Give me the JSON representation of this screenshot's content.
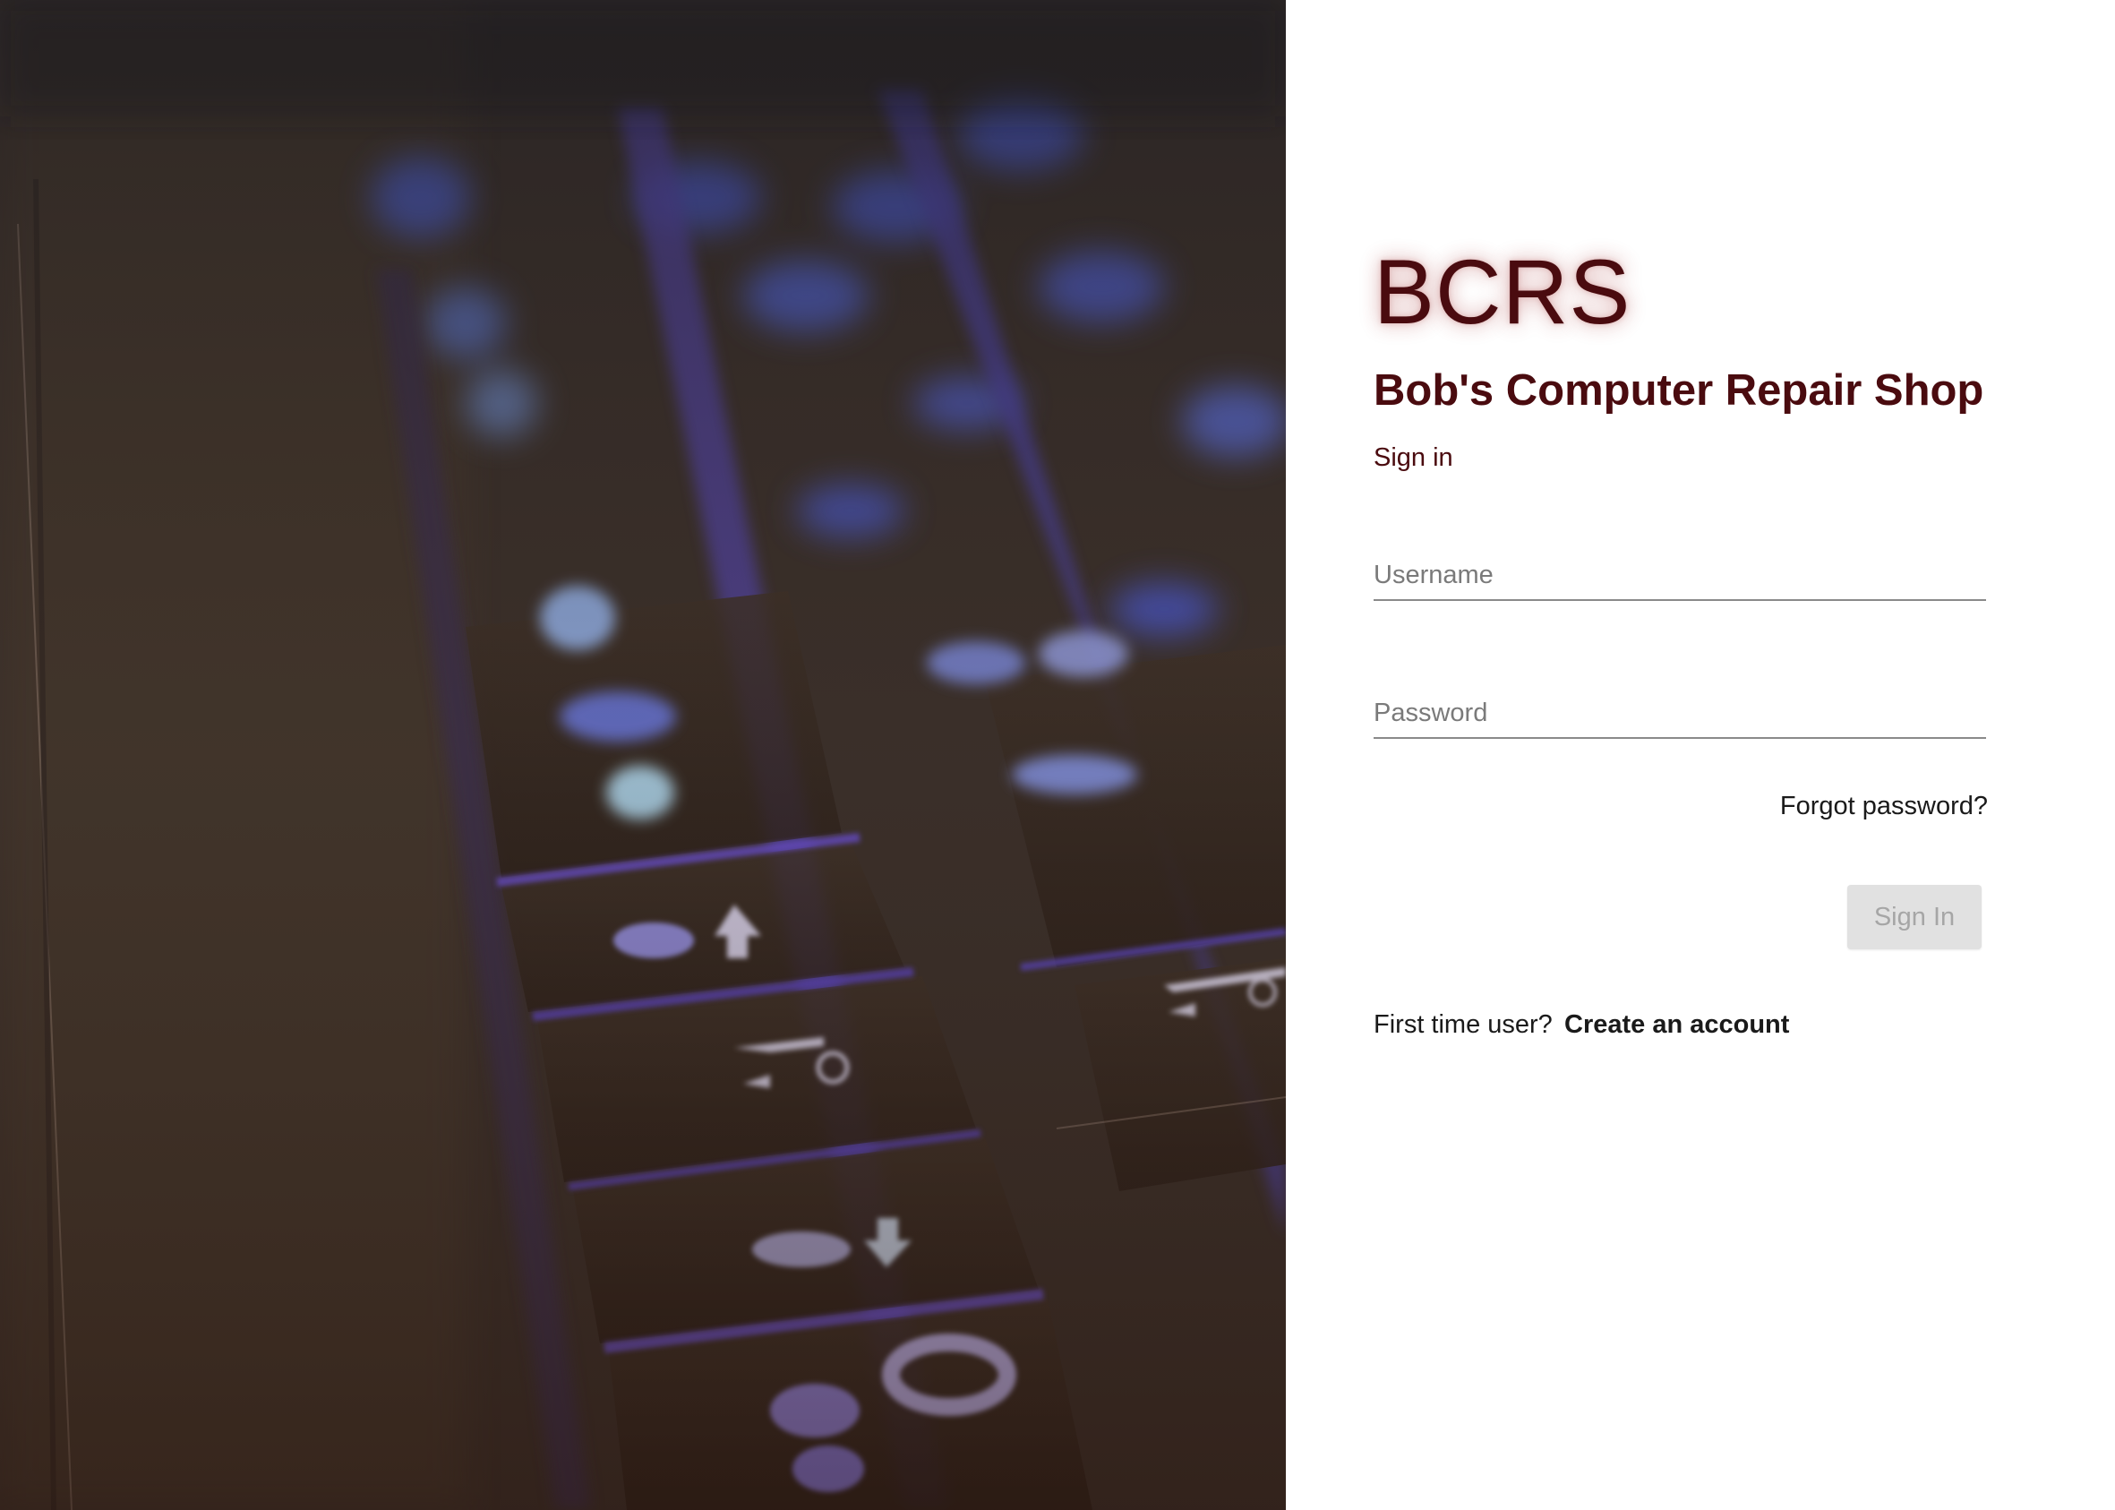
{
  "brand": {
    "logo_text": "BCRS",
    "shop_name": "Bob's Computer Repair Shop"
  },
  "form": {
    "heading": "Sign in",
    "username": {
      "value": "",
      "placeholder": "Username"
    },
    "password": {
      "value": "",
      "placeholder": "Password"
    },
    "forgot_password_label": "Forgot password?",
    "submit_label": "Sign In",
    "submit_disabled": true
  },
  "footer": {
    "first_time_label": "First time user?",
    "create_account_label": "Create an account"
  },
  "colors": {
    "brand_maroon": "#4a0b0f",
    "disabled_button_bg": "#e1e1e1",
    "disabled_button_text": "#a6a6a6"
  },
  "background_image": {
    "subject": "backlit laptop keyboard close-up"
  }
}
